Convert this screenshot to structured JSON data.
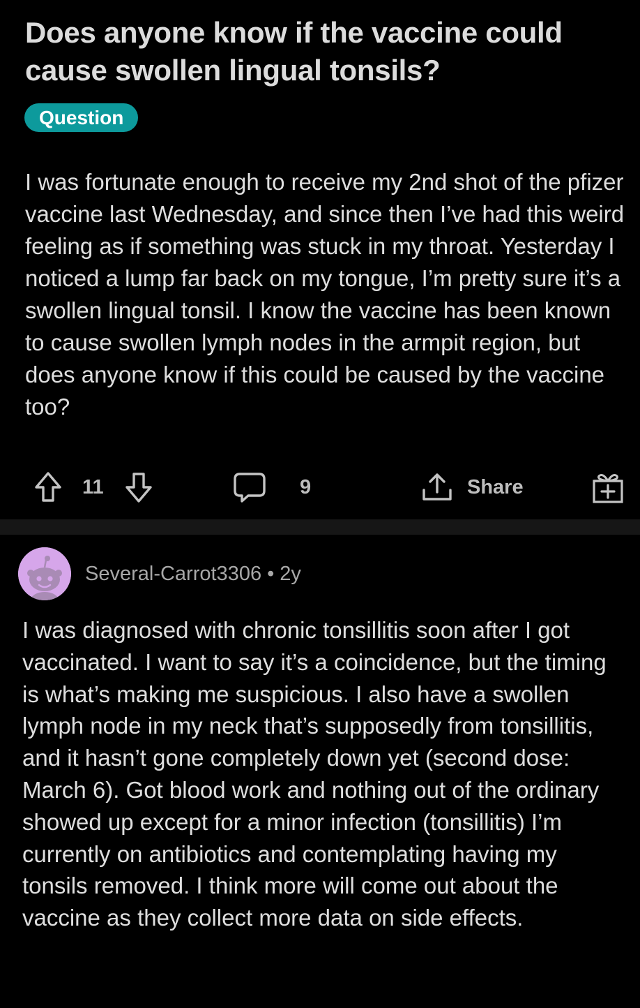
{
  "post": {
    "title": "Does anyone know if the vaccine could cause swollen lingual tonsils?",
    "flair": "Question",
    "flair_color": "#0d9a9c",
    "body": "I was fortunate enough to receive my 2nd shot of the pfizer vaccine last Wednesday, and since then I’ve had this weird feeling as if something was stuck in my throat. Yesterday I noticed a lump far back on my tongue, I’m pretty sure it’s a swollen lingual tonsil. I know the vaccine has been known to cause swollen lymph nodes in the armpit region, but does anyone know if this could be caused by the vaccine too?",
    "actions": {
      "upvote_icon": "arrow-up-icon",
      "score": "11",
      "downvote_icon": "arrow-down-icon",
      "comment_icon": "speech-bubble-icon",
      "comments": "9",
      "share_icon": "share-upload-icon",
      "share_label": "Share",
      "award_icon": "gift-box-icon"
    }
  },
  "comment": {
    "avatar_icon": "snoo-avatar-icon",
    "avatar_color": "#d6a6ea",
    "username": "Several-Carrot3306",
    "separator": "•",
    "age": "2y",
    "body": "I was diagnosed with chronic tonsillitis soon after I got vaccinated. I want to say it’s a coincidence, but the timing is what’s making me suspicious. I also have a swollen lymph node in my neck that’s supposedly from tonsillitis, and it hasn’t gone completely down yet (second dose: March 6). Got blood work and nothing out of the ordinary showed up except for a minor infection (tonsillitis) I’m currently on antibiotics and contemplating having my tonsils removed. I think more will come out about the vaccine as they collect more data on side effects."
  }
}
